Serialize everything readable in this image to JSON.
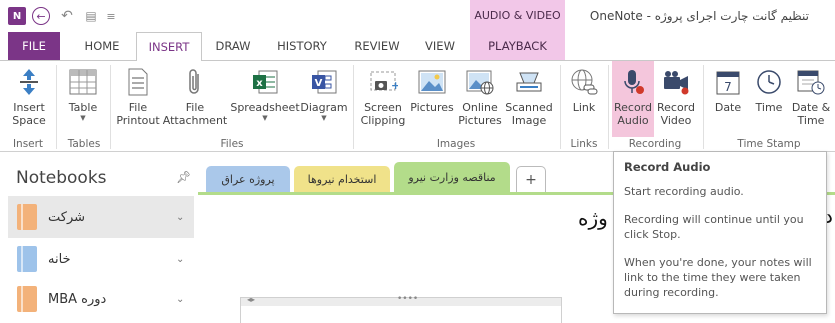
{
  "titlebar": {
    "app_logo": "N",
    "window_title": "تنظيم گانت چارت اجراى پروژه - OneNote",
    "context_group": "AUDIO & VIDEO"
  },
  "tabs": {
    "file": "FILE",
    "home": "HOME",
    "insert": "INSERT",
    "draw": "DRAW",
    "history": "HISTORY",
    "review": "REVIEW",
    "view": "VIEW",
    "playback": "PLAYBACK"
  },
  "ribbon": {
    "buttons": {
      "insert_space": "Insert\nSpace",
      "table": "Table",
      "file_printout": "File\nPrintout",
      "file_attachment": "File\nAttachment",
      "spreadsheet": "Spreadsheet",
      "diagram": "Diagram",
      "screen_clipping": "Screen\nClipping",
      "pictures": "Pictures",
      "online_pictures": "Online\nPictures",
      "scanned_image": "Scanned\nImage",
      "link": "Link",
      "record_audio": "Record\nAudio",
      "record_video": "Record\nVideo",
      "date": "Date",
      "time": "Time",
      "date_time": "Date &\nTime"
    },
    "groups": {
      "insert": "Insert",
      "tables": "Tables",
      "files": "Files",
      "images": "Images",
      "links": "Links",
      "recording": "Recording",
      "time_stamp": "Time Stamp"
    },
    "date_icon_number": "7"
  },
  "notebooks": {
    "title": "Notebooks",
    "items": [
      {
        "name": "شركت",
        "color": "#f3b27a"
      },
      {
        "name": "خانه",
        "color": "#9ec3ea"
      },
      {
        "name": "MBA دوره",
        "color": "#f3b27a"
      }
    ]
  },
  "sections": {
    "tabs": [
      {
        "label": "پروژه عراق",
        "color": "#aac8ea"
      },
      {
        "label": "استخدام نيروها",
        "color": "#f0e28a"
      },
      {
        "label": "مناقصه وزارت نيرو",
        "color": "#b3dc8a"
      }
    ],
    "add": "+"
  },
  "page": {
    "title_fragment": "وژه",
    "title_edge": "د"
  },
  "tooltip": {
    "title": "Record Audio",
    "line1": "Start recording audio.",
    "line2": "Recording will continue until you click Stop.",
    "line3": "When you're done, your notes will link to the time they were taken during recording."
  },
  "colors": {
    "accent": "#7b3587",
    "context_tab": "#f2c7e8",
    "record_audio_highlight": "#f4c6dc"
  }
}
